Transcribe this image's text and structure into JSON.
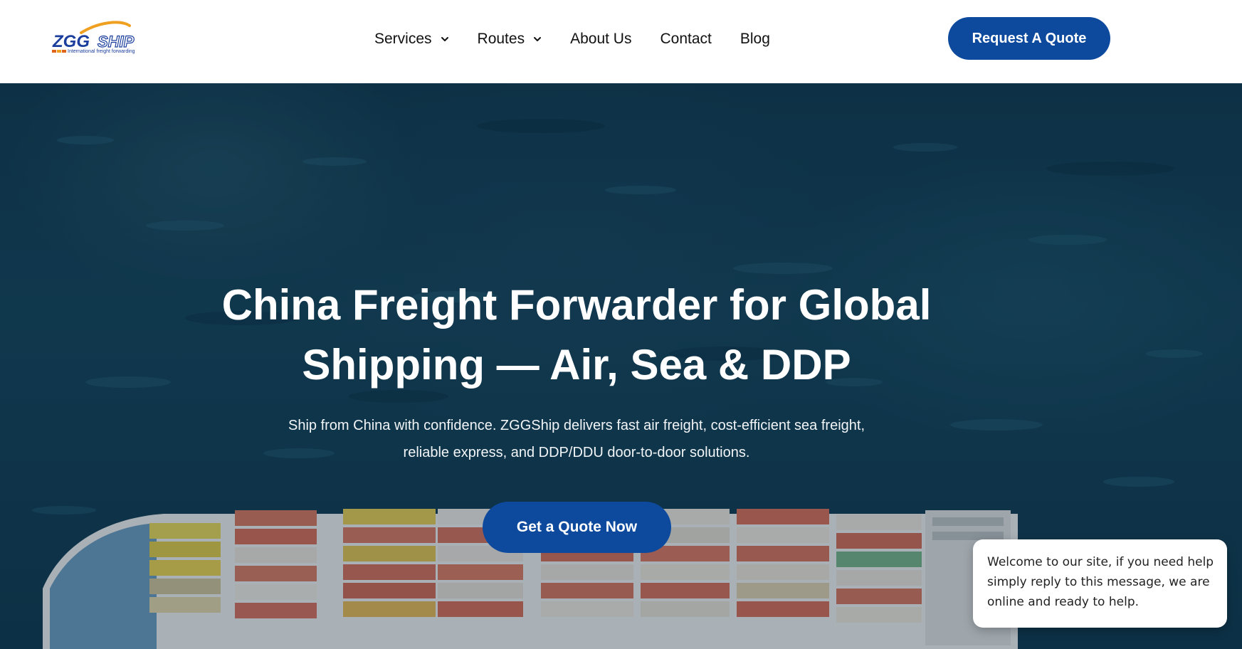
{
  "header": {
    "logo": {
      "brand": "ZGGSHIP",
      "tagline": "International freight forwarding"
    },
    "nav": [
      {
        "label": "Services",
        "has_dropdown": true
      },
      {
        "label": "Routes",
        "has_dropdown": true
      },
      {
        "label": "About Us",
        "has_dropdown": false
      },
      {
        "label": "Contact",
        "has_dropdown": false
      },
      {
        "label": "Blog",
        "has_dropdown": false
      }
    ],
    "cta_label": "Request A Quote"
  },
  "hero": {
    "title_line1": "China Freight Forwarder for Global",
    "title_line2": "Shipping — Air, Sea & DDP",
    "subtitle_line1": "Ship from China with confidence. ZGGShip delivers fast air freight, cost-efficient sea freight,",
    "subtitle_line2": "reliable express, and DDP/DDU door-to-door solutions.",
    "cta_label": "Get a Quote Now"
  },
  "chat": {
    "line1": "Welcome to our site, if you need help",
    "line2": "simply reply to this message, we are",
    "line3": "online and ready to help."
  },
  "colors": {
    "accent": "#0d4a9e",
    "logo_orange": "#f0a020",
    "logo_blue": "#1c3f9e",
    "ocean": "#14445c"
  },
  "icons": {
    "dropdown": "chevron-down-icon"
  }
}
